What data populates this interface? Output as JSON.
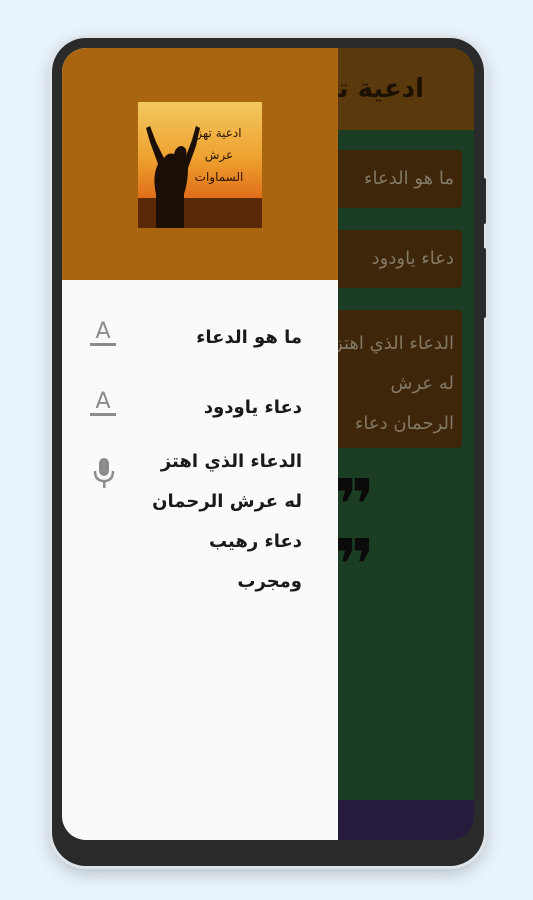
{
  "app": {
    "title": "ادعية تهز عرش السماوات",
    "cards": [
      {
        "label": "ما هو الدعاء"
      },
      {
        "label": "دعاء ياودود"
      },
      {
        "label": "الدعاء الذي اهتز له عرش الرحمان دعاء رهيب"
      }
    ]
  },
  "drawer": {
    "logo_text": "ادعية تهز عرش السماوات",
    "items": [
      {
        "label": "ما هو الدعاء",
        "icon": "font-icon"
      },
      {
        "label": "دعاء ياودود",
        "icon": "font-icon"
      },
      {
        "label": "الدعاء الذي اهتز له عرش الرحمان دعاء رهيب ومجرب",
        "icon": "microphone-icon"
      }
    ]
  },
  "colors": {
    "drawer_header": "#a9650f",
    "app_bar": "#8a5a14",
    "background_green": "#2a5f36",
    "card": "#5f3b10"
  }
}
